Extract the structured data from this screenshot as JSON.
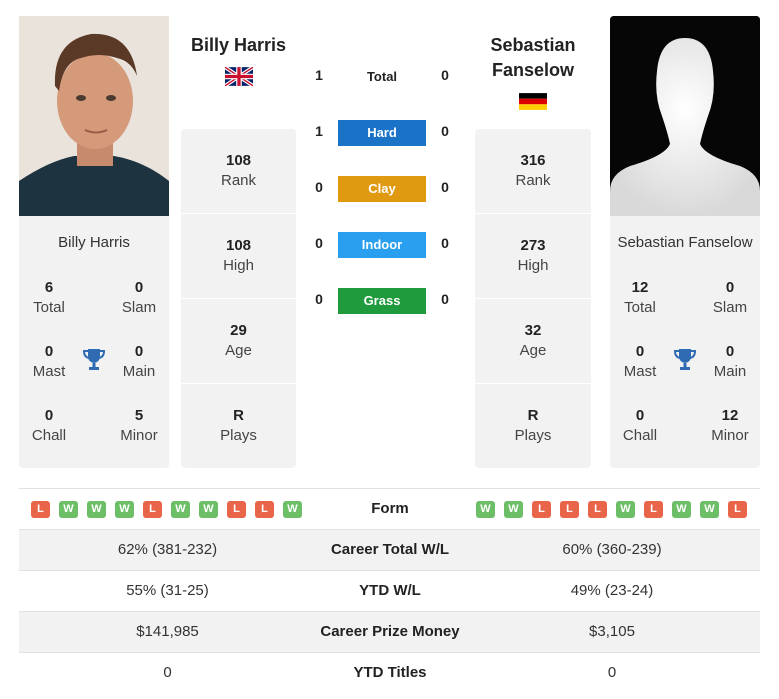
{
  "players": {
    "left": {
      "name": "Billy Harris",
      "card_name": "Billy Harris",
      "flag": "united-kingdom",
      "stats": {
        "total": {
          "value": "6",
          "label": "Total"
        },
        "slam": {
          "value": "0",
          "label": "Slam"
        },
        "mast": {
          "value": "0",
          "label": "Mast"
        },
        "main": {
          "value": "0",
          "label": "Main"
        },
        "chall": {
          "value": "0",
          "label": "Chall"
        },
        "minor": {
          "value": "5",
          "label": "Minor"
        }
      },
      "rank_column": [
        {
          "value": "108",
          "label": "Rank"
        },
        {
          "value": "108",
          "label": "High"
        },
        {
          "value": "29",
          "label": "Age"
        },
        {
          "value": "R",
          "label": "Plays"
        }
      ]
    },
    "right": {
      "name_line1": "Sebastian",
      "name_line2": "Fanselow",
      "card_name": "Sebastian Fanselow",
      "flag": "germany",
      "stats": {
        "total": {
          "value": "12",
          "label": "Total"
        },
        "slam": {
          "value": "0",
          "label": "Slam"
        },
        "mast": {
          "value": "0",
          "label": "Mast"
        },
        "main": {
          "value": "0",
          "label": "Main"
        },
        "chall": {
          "value": "0",
          "label": "Chall"
        },
        "minor": {
          "value": "12",
          "label": "Minor"
        }
      },
      "rank_column": [
        {
          "value": "316",
          "label": "Rank"
        },
        {
          "value": "273",
          "label": "High"
        },
        {
          "value": "32",
          "label": "Age"
        },
        {
          "value": "R",
          "label": "Plays"
        }
      ]
    }
  },
  "h2h": {
    "total": {
      "label": "Total",
      "left": "1",
      "right": "0"
    },
    "surfaces": [
      {
        "label": "Hard",
        "left": "1",
        "right": "0",
        "color": "#1a73c6"
      },
      {
        "label": "Clay",
        "left": "0",
        "right": "0",
        "color": "#e09a12"
      },
      {
        "label": "Indoor",
        "left": "0",
        "right": "0",
        "color": "#2a9ff0"
      },
      {
        "label": "Grass",
        "left": "0",
        "right": "0",
        "color": "#1f9a3c"
      }
    ]
  },
  "table": {
    "form": {
      "label": "Form",
      "left": [
        "L",
        "W",
        "W",
        "W",
        "L",
        "W",
        "W",
        "L",
        "L",
        "W"
      ],
      "right": [
        "W",
        "W",
        "L",
        "L",
        "L",
        "W",
        "L",
        "W",
        "W",
        "L"
      ]
    },
    "rows": [
      {
        "label": "Career Total W/L",
        "left": "62% (381-232)",
        "right": "60% (360-239)"
      },
      {
        "label": "YTD W/L",
        "left": "55% (31-25)",
        "right": "49% (23-24)"
      },
      {
        "label": "Career Prize Money",
        "left": "$141,985",
        "right": "$3,105"
      },
      {
        "label": "YTD Titles",
        "left": "0",
        "right": "0"
      }
    ]
  },
  "colors": {
    "win": "#6dbf67",
    "loss": "#e8654a",
    "trophy": "#2f6bb3",
    "panel": "#f2f2f2"
  }
}
